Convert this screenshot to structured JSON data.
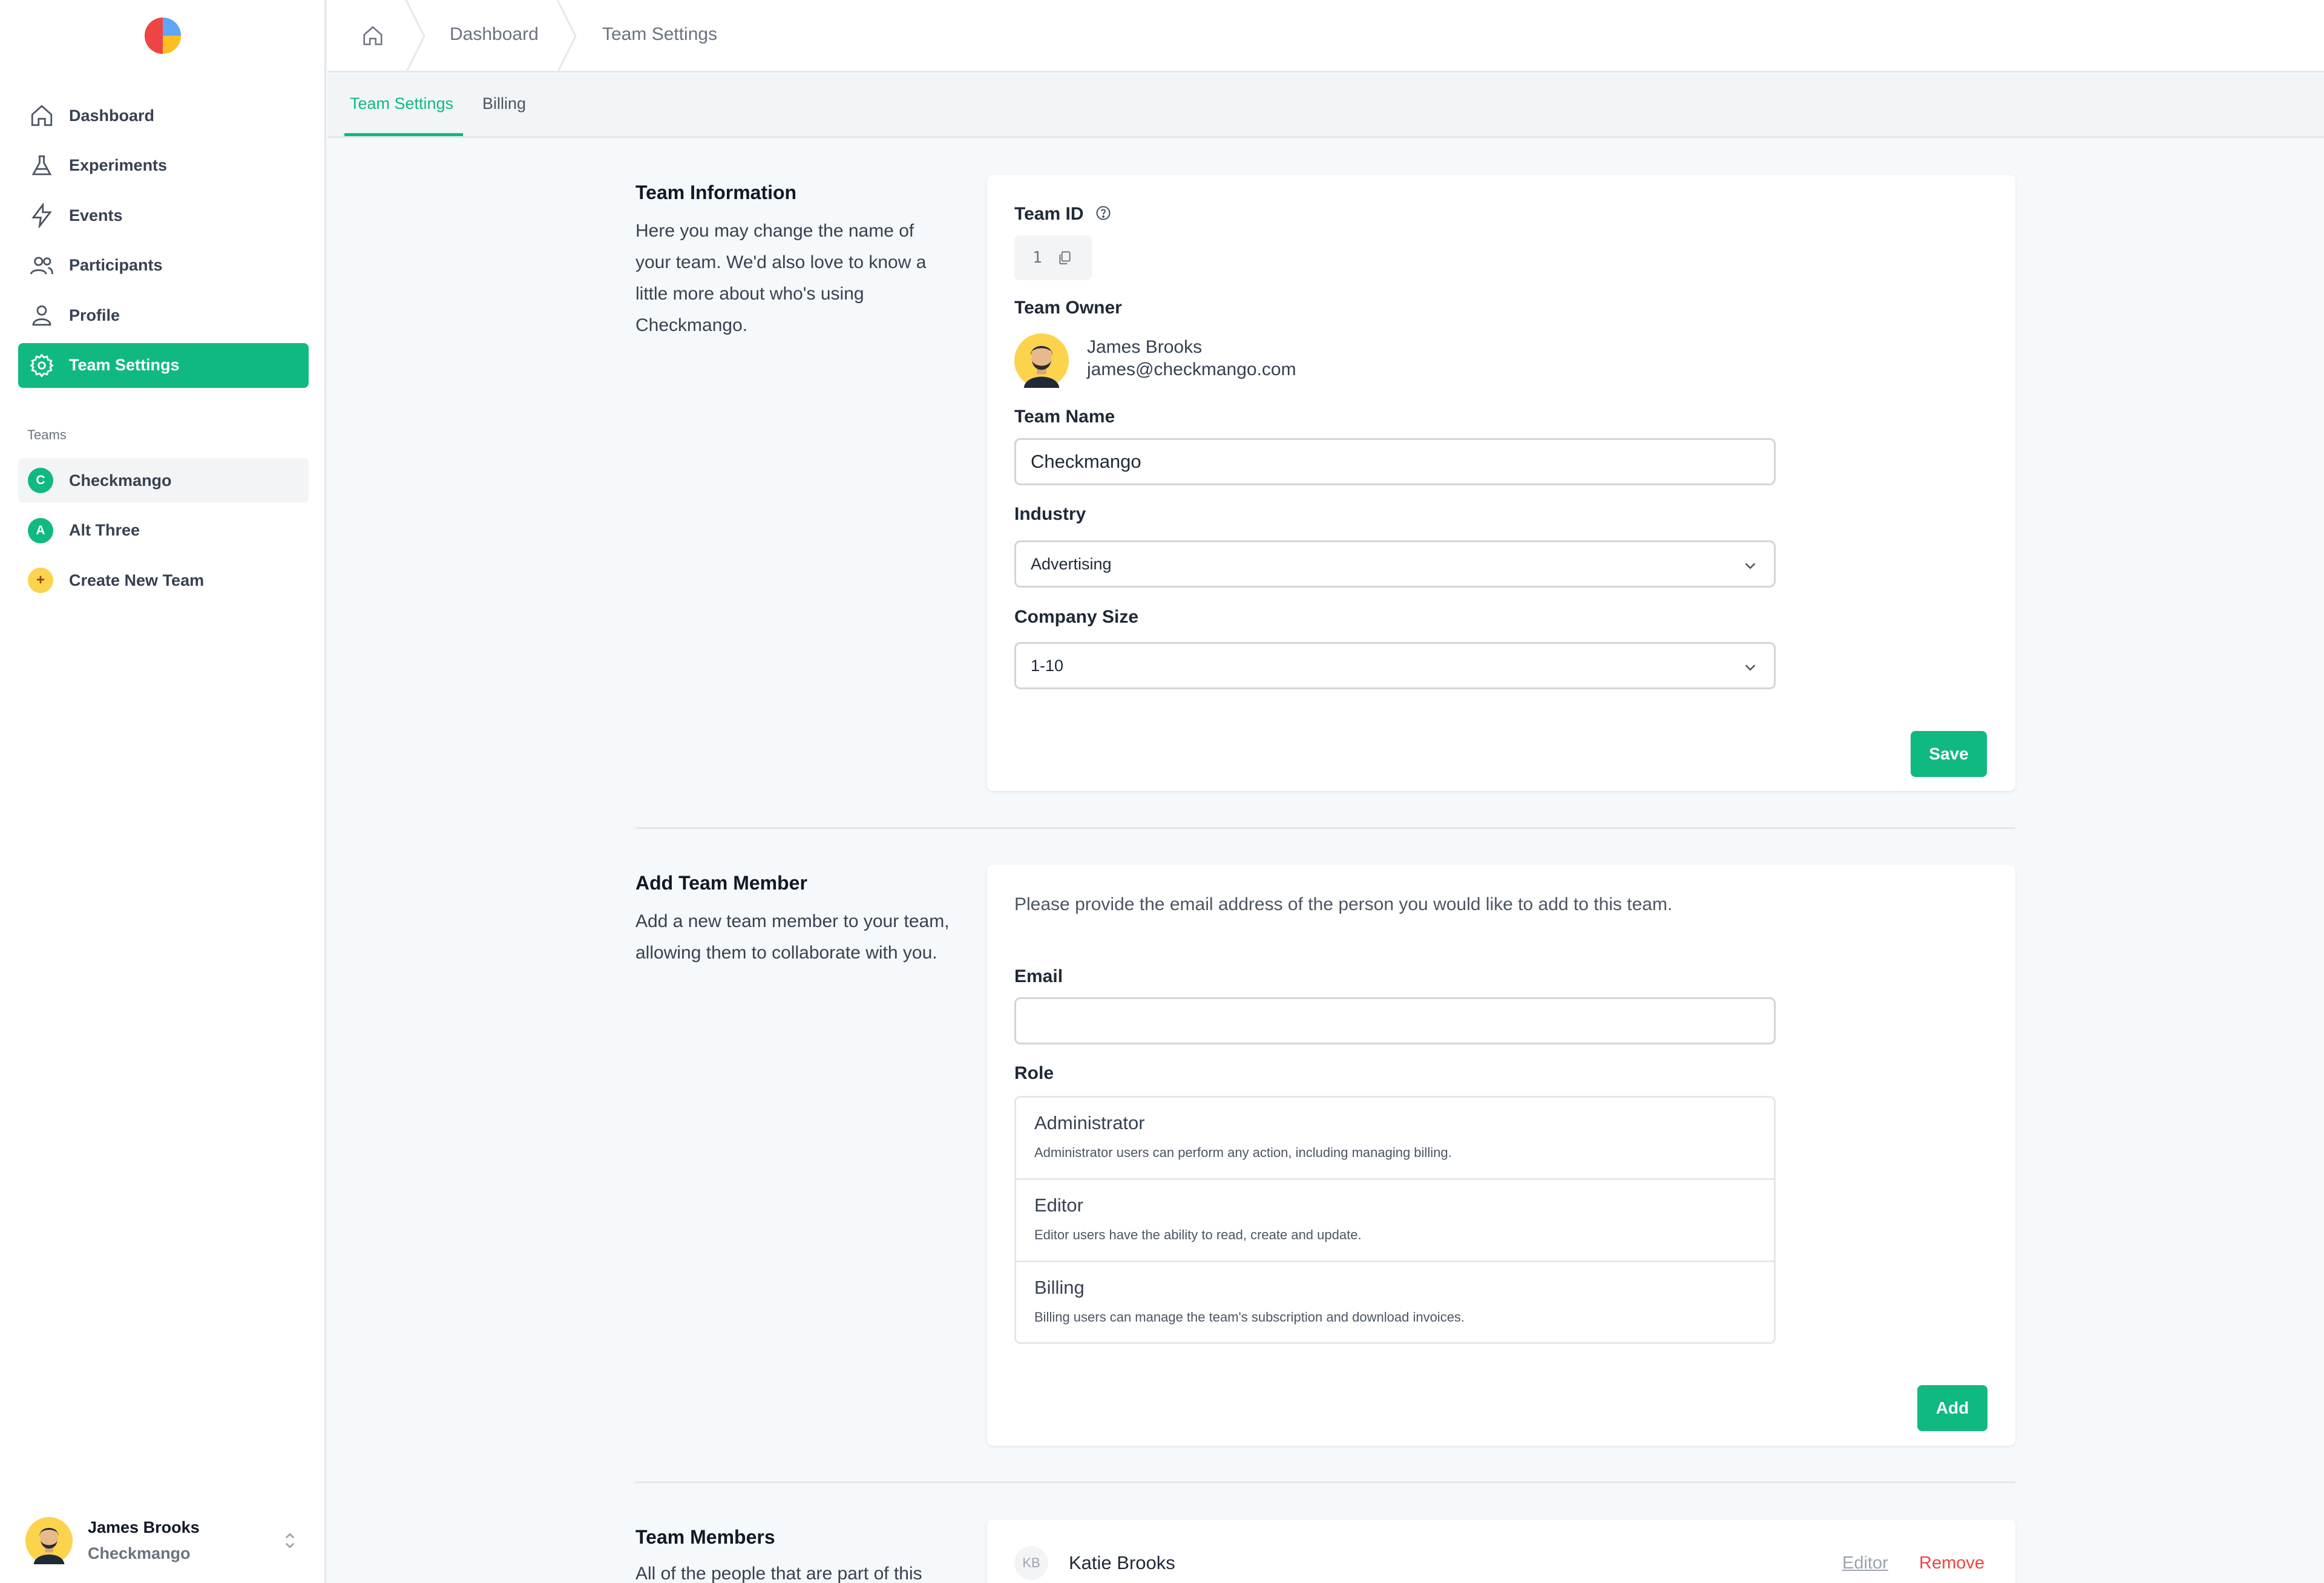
{
  "sidebar": {
    "nav": [
      {
        "label": "Dashboard",
        "icon": "home-icon"
      },
      {
        "label": "Experiments",
        "icon": "flask-icon"
      },
      {
        "label": "Events",
        "icon": "lightning-icon"
      },
      {
        "label": "Participants",
        "icon": "users-icon"
      },
      {
        "label": "Profile",
        "icon": "user-icon"
      },
      {
        "label": "Team Settings",
        "icon": "gear-icon",
        "active": true
      }
    ],
    "teams_label": "Teams",
    "teams": [
      {
        "initial": "C",
        "label": "Checkmango"
      },
      {
        "initial": "A",
        "label": "Alt Three"
      },
      {
        "initial": "+",
        "label": "Create New Team"
      }
    ],
    "user": {
      "name": "James Brooks",
      "team": "Checkmango"
    }
  },
  "breadcrumb": {
    "items": [
      "Dashboard",
      "Team Settings"
    ]
  },
  "tabs": [
    "Team Settings",
    "Billing"
  ],
  "team_info": {
    "title": "Team Information",
    "description": "Here you may change the name of your team. We'd also love to know a little more about who's using Checkmango.",
    "team_id_label": "Team ID",
    "team_id": "1",
    "owner_label": "Team Owner",
    "owner_name": "James Brooks",
    "owner_email": "james@checkmango.com",
    "name_label": "Team Name",
    "name_value": "Checkmango",
    "industry_label": "Industry",
    "industry_value": "Advertising",
    "size_label": "Company Size",
    "size_value": "1-10",
    "save_label": "Save"
  },
  "add_member": {
    "title": "Add Team Member",
    "description": "Add a new team member to your team, allowing them to collaborate with you.",
    "instructions": "Please provide the email address of the person you would like to add to this team.",
    "email_label": "Email",
    "email_value": "",
    "role_label": "Role",
    "roles": [
      {
        "name": "Administrator",
        "description": "Administrator users can perform any action, including managing billing."
      },
      {
        "name": "Editor",
        "description": "Editor users have the ability to read, create and update."
      },
      {
        "name": "Billing",
        "description": "Billing users can manage the team's subscription and download invoices."
      }
    ],
    "add_label": "Add"
  },
  "members": {
    "title": "Team Members",
    "description": "All of the people that are part of this",
    "list": [
      {
        "initials": "KB",
        "name": "Katie Brooks",
        "role": "Editor",
        "remove_label": "Remove"
      }
    ]
  },
  "colors": {
    "accent": "#10b981",
    "danger": "#ef4444"
  }
}
